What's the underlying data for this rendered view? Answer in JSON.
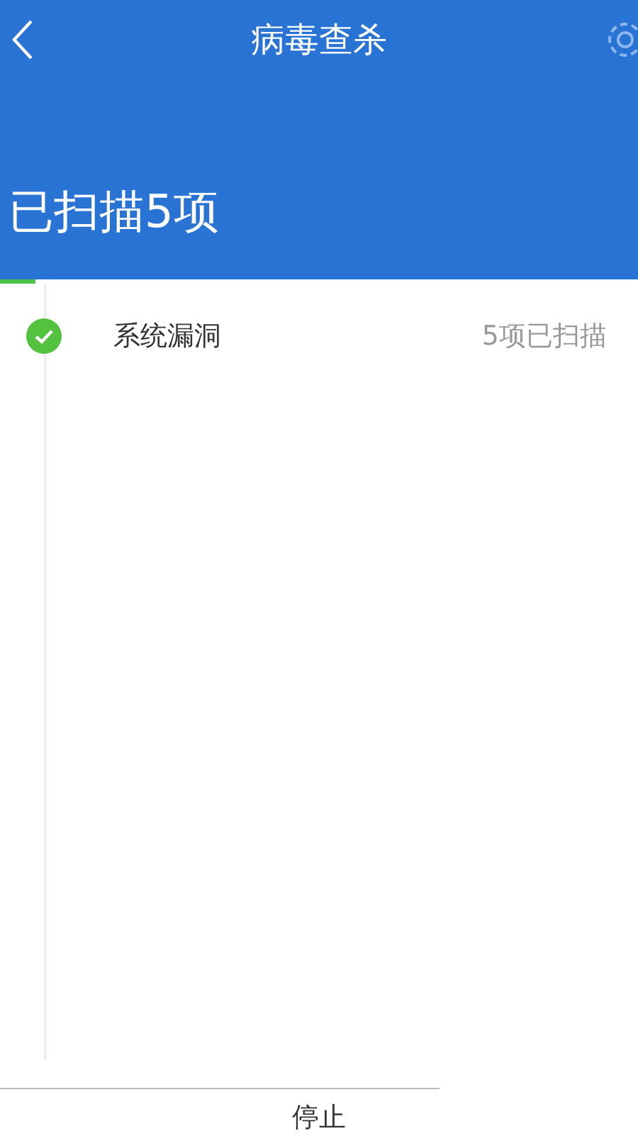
{
  "header": {
    "title": "病毒查杀",
    "summary": "已扫描5项"
  },
  "progress": {
    "level": 0.055
  },
  "items": [
    {
      "name": "系统漏洞",
      "status": "5项已扫描",
      "done": true
    }
  ],
  "stop_button": "停止"
}
